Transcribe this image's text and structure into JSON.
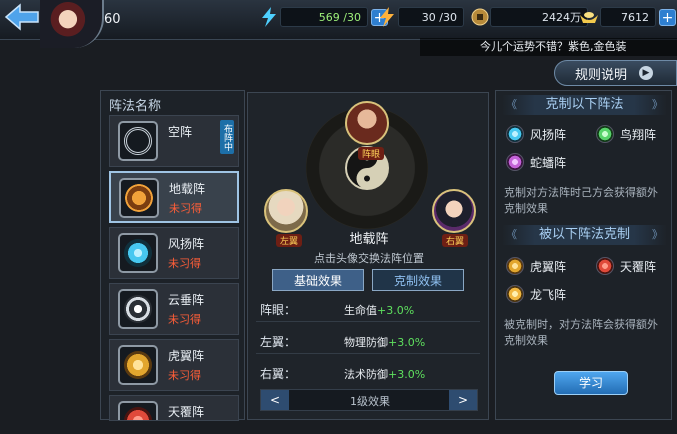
{
  "player": {
    "level": "60"
  },
  "resources": [
    {
      "name": "energy",
      "value": "569 /30",
      "color": "#4ed0ff"
    },
    {
      "name": "stamina",
      "value": "30 /30",
      "color": "#ffb23c"
    },
    {
      "name": "coins",
      "value": "2424万",
      "color": "#d6a94c"
    },
    {
      "name": "gold",
      "value": "7612",
      "color": "#f2c94c"
    }
  ],
  "ticker": "今儿个运势不错？紫色,金色装",
  "rules_label": "规则说明",
  "left_panel": {
    "title": "阵法名称",
    "items": [
      {
        "name": "空阵",
        "status": "",
        "badge": "布阵中",
        "color": "#c9d2da"
      },
      {
        "name": "地载阵",
        "status": "未习得",
        "color": "#f1a23a"
      },
      {
        "name": "风扬阵",
        "status": "未习得",
        "color": "#47c8f0"
      },
      {
        "name": "云垂阵",
        "status": "未习得",
        "color": "#d7dde3"
      },
      {
        "name": "虎翼阵",
        "status": "未习得",
        "color": "#e2a62e"
      },
      {
        "name": "天覆阵",
        "status": "",
        "color": "#e04a3a"
      }
    ]
  },
  "center": {
    "heroes": {
      "front": "阵眼",
      "left": "左翼",
      "right": "右翼"
    },
    "formation_name": "地载阵",
    "hint": "点击头像交换法阵位置",
    "tabs": [
      "基础效果",
      "克制效果"
    ],
    "stats": [
      {
        "pos": "阵眼：",
        "attr": "生命值",
        "bonus": "+3.0%"
      },
      {
        "pos": "左翼：",
        "attr": "物理防御",
        "bonus": "+3.0%"
      },
      {
        "pos": "右翼：",
        "attr": "法术防御",
        "bonus": "+3.0%"
      }
    ],
    "pager_label": "1级效果",
    "prev": "<",
    "next": ">"
  },
  "right_panel": {
    "counters_title": "克制以下阵法",
    "counters": [
      {
        "name": "风扬阵",
        "color": "#47c8f0"
      },
      {
        "name": "鸟翔阵",
        "color": "#58d36a"
      },
      {
        "name": "蛇蟠阵",
        "color": "#c462d8"
      }
    ],
    "counters_desc": "克制对方法阵时己方会获得额外克制效果",
    "countered_title": "被以下阵法克制",
    "countered": [
      {
        "name": "虎翼阵",
        "color": "#e2a62e"
      },
      {
        "name": "天覆阵",
        "color": "#e04a3a"
      },
      {
        "name": "龙飞阵",
        "color": "#f0b640"
      }
    ],
    "countered_desc": "被克制时，对方法阵会获得额外克制效果",
    "learn_label": "学习"
  }
}
